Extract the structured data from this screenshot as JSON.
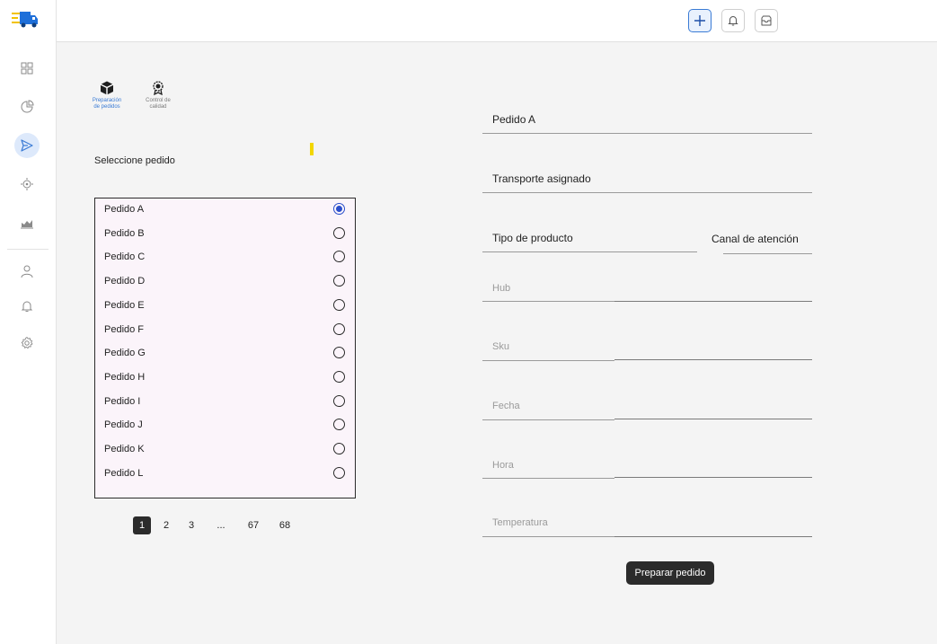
{
  "header": {
    "add_icon": "plus-icon",
    "notifications_icon": "bell-icon",
    "inbox_icon": "inbox-icon"
  },
  "sidebar": {
    "logo": "truck-logo",
    "items": [
      {
        "id": "dashboard",
        "icon": "grid-icon"
      },
      {
        "id": "reports",
        "icon": "pie-chart-icon"
      },
      {
        "id": "send",
        "icon": "send-icon",
        "active": true
      },
      {
        "id": "tracking",
        "icon": "target-icon"
      },
      {
        "id": "analytics",
        "icon": "area-chart-icon"
      },
      {
        "id": "profile",
        "icon": "user-icon"
      },
      {
        "id": "alerts",
        "icon": "bell-icon"
      },
      {
        "id": "settings",
        "icon": "gear-icon"
      }
    ]
  },
  "steps": [
    {
      "label1": "Preparación",
      "label2": "de pedidos",
      "icon": "package-icon",
      "active": true
    },
    {
      "label1": "Control de",
      "label2": "calidad",
      "icon": "award-icon",
      "active": false
    }
  ],
  "orders": {
    "title": "Seleccione pedido",
    "items": [
      {
        "label": "Pedido A",
        "selected": true
      },
      {
        "label": "Pedido B",
        "selected": false
      },
      {
        "label": "Pedido C",
        "selected": false
      },
      {
        "label": "Pedido D",
        "selected": false
      },
      {
        "label": "Pedido E",
        "selected": false
      },
      {
        "label": "Pedido F",
        "selected": false
      },
      {
        "label": "Pedido G",
        "selected": false
      },
      {
        "label": "Pedido H",
        "selected": false
      },
      {
        "label": "Pedido I",
        "selected": false
      },
      {
        "label": "Pedido J",
        "selected": false
      },
      {
        "label": "Pedido K",
        "selected": false
      },
      {
        "label": "Pedido L",
        "selected": false
      }
    ]
  },
  "pagination": {
    "pages": [
      "1",
      "2",
      "3",
      "...",
      "67",
      "68"
    ],
    "current": "1"
  },
  "form": {
    "pedido": "Pedido A",
    "transporte": "Transporte asignado",
    "tipo_producto": "Tipo de producto",
    "canal": "Canal de atención",
    "hub_placeholder": "Hub",
    "sku_placeholder": "Sku",
    "fecha_placeholder": "Fecha",
    "hora_placeholder": "Hora",
    "temperatura_placeholder": "Temperatura"
  },
  "actions": {
    "submit_label": "Preparar pedido"
  },
  "colors": {
    "accent": "#3a7bd5",
    "radio_selected": "#2a4ecb",
    "list_background": "#fbf4fa",
    "main_background": "#f4f4f4",
    "highlight_mark": "#f2d600"
  }
}
